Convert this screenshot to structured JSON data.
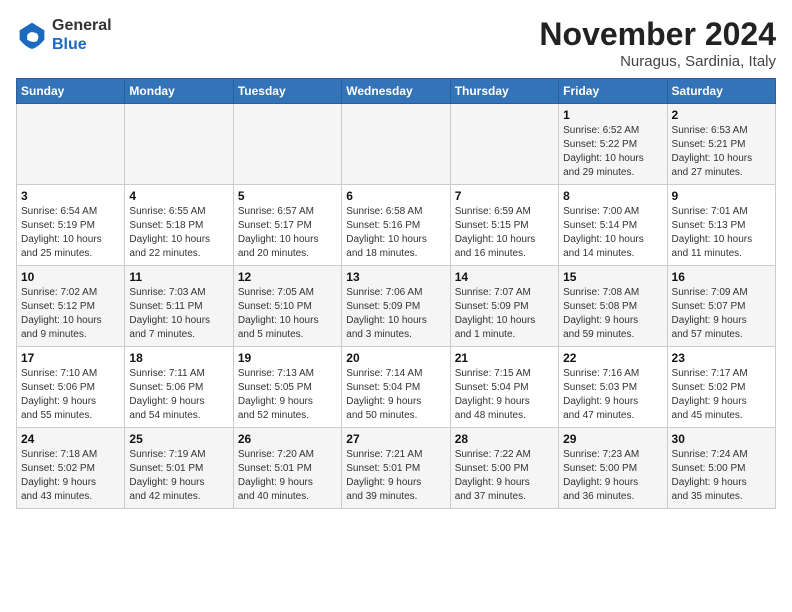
{
  "header": {
    "logo": {
      "general": "General",
      "blue": "Blue"
    },
    "title": "November 2024",
    "location": "Nuragus, Sardinia, Italy"
  },
  "calendar": {
    "days_of_week": [
      "Sunday",
      "Monday",
      "Tuesday",
      "Wednesday",
      "Thursday",
      "Friday",
      "Saturday"
    ],
    "weeks": [
      [
        {
          "day": "",
          "info": ""
        },
        {
          "day": "",
          "info": ""
        },
        {
          "day": "",
          "info": ""
        },
        {
          "day": "",
          "info": ""
        },
        {
          "day": "",
          "info": ""
        },
        {
          "day": "1",
          "info": "Sunrise: 6:52 AM\nSunset: 5:22 PM\nDaylight: 10 hours\nand 29 minutes."
        },
        {
          "day": "2",
          "info": "Sunrise: 6:53 AM\nSunset: 5:21 PM\nDaylight: 10 hours\nand 27 minutes."
        }
      ],
      [
        {
          "day": "3",
          "info": "Sunrise: 6:54 AM\nSunset: 5:19 PM\nDaylight: 10 hours\nand 25 minutes."
        },
        {
          "day": "4",
          "info": "Sunrise: 6:55 AM\nSunset: 5:18 PM\nDaylight: 10 hours\nand 22 minutes."
        },
        {
          "day": "5",
          "info": "Sunrise: 6:57 AM\nSunset: 5:17 PM\nDaylight: 10 hours\nand 20 minutes."
        },
        {
          "day": "6",
          "info": "Sunrise: 6:58 AM\nSunset: 5:16 PM\nDaylight: 10 hours\nand 18 minutes."
        },
        {
          "day": "7",
          "info": "Sunrise: 6:59 AM\nSunset: 5:15 PM\nDaylight: 10 hours\nand 16 minutes."
        },
        {
          "day": "8",
          "info": "Sunrise: 7:00 AM\nSunset: 5:14 PM\nDaylight: 10 hours\nand 14 minutes."
        },
        {
          "day": "9",
          "info": "Sunrise: 7:01 AM\nSunset: 5:13 PM\nDaylight: 10 hours\nand 11 minutes."
        }
      ],
      [
        {
          "day": "10",
          "info": "Sunrise: 7:02 AM\nSunset: 5:12 PM\nDaylight: 10 hours\nand 9 minutes."
        },
        {
          "day": "11",
          "info": "Sunrise: 7:03 AM\nSunset: 5:11 PM\nDaylight: 10 hours\nand 7 minutes."
        },
        {
          "day": "12",
          "info": "Sunrise: 7:05 AM\nSunset: 5:10 PM\nDaylight: 10 hours\nand 5 minutes."
        },
        {
          "day": "13",
          "info": "Sunrise: 7:06 AM\nSunset: 5:09 PM\nDaylight: 10 hours\nand 3 minutes."
        },
        {
          "day": "14",
          "info": "Sunrise: 7:07 AM\nSunset: 5:09 PM\nDaylight: 10 hours\nand 1 minute."
        },
        {
          "day": "15",
          "info": "Sunrise: 7:08 AM\nSunset: 5:08 PM\nDaylight: 9 hours\nand 59 minutes."
        },
        {
          "day": "16",
          "info": "Sunrise: 7:09 AM\nSunset: 5:07 PM\nDaylight: 9 hours\nand 57 minutes."
        }
      ],
      [
        {
          "day": "17",
          "info": "Sunrise: 7:10 AM\nSunset: 5:06 PM\nDaylight: 9 hours\nand 55 minutes."
        },
        {
          "day": "18",
          "info": "Sunrise: 7:11 AM\nSunset: 5:06 PM\nDaylight: 9 hours\nand 54 minutes."
        },
        {
          "day": "19",
          "info": "Sunrise: 7:13 AM\nSunset: 5:05 PM\nDaylight: 9 hours\nand 52 minutes."
        },
        {
          "day": "20",
          "info": "Sunrise: 7:14 AM\nSunset: 5:04 PM\nDaylight: 9 hours\nand 50 minutes."
        },
        {
          "day": "21",
          "info": "Sunrise: 7:15 AM\nSunset: 5:04 PM\nDaylight: 9 hours\nand 48 minutes."
        },
        {
          "day": "22",
          "info": "Sunrise: 7:16 AM\nSunset: 5:03 PM\nDaylight: 9 hours\nand 47 minutes."
        },
        {
          "day": "23",
          "info": "Sunrise: 7:17 AM\nSunset: 5:02 PM\nDaylight: 9 hours\nand 45 minutes."
        }
      ],
      [
        {
          "day": "24",
          "info": "Sunrise: 7:18 AM\nSunset: 5:02 PM\nDaylight: 9 hours\nand 43 minutes."
        },
        {
          "day": "25",
          "info": "Sunrise: 7:19 AM\nSunset: 5:01 PM\nDaylight: 9 hours\nand 42 minutes."
        },
        {
          "day": "26",
          "info": "Sunrise: 7:20 AM\nSunset: 5:01 PM\nDaylight: 9 hours\nand 40 minutes."
        },
        {
          "day": "27",
          "info": "Sunrise: 7:21 AM\nSunset: 5:01 PM\nDaylight: 9 hours\nand 39 minutes."
        },
        {
          "day": "28",
          "info": "Sunrise: 7:22 AM\nSunset: 5:00 PM\nDaylight: 9 hours\nand 37 minutes."
        },
        {
          "day": "29",
          "info": "Sunrise: 7:23 AM\nSunset: 5:00 PM\nDaylight: 9 hours\nand 36 minutes."
        },
        {
          "day": "30",
          "info": "Sunrise: 7:24 AM\nSunset: 5:00 PM\nDaylight: 9 hours\nand 35 minutes."
        }
      ]
    ]
  }
}
